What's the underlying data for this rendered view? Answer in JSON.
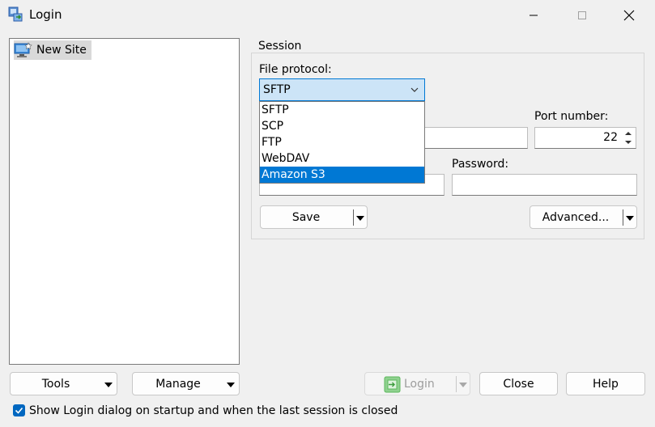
{
  "window": {
    "title": "Login"
  },
  "site_tree": {
    "items": [
      {
        "label": "New Site",
        "selected": true
      }
    ]
  },
  "session": {
    "legend": "Session",
    "file_protocol": {
      "label": "File protocol:",
      "value": "SFTP",
      "options": [
        "SFTP",
        "SCP",
        "FTP",
        "WebDAV",
        "Amazon S3"
      ],
      "highlighted": "Amazon S3"
    },
    "port": {
      "label": "Port number:",
      "value": "22"
    },
    "password": {
      "label": "Password:",
      "value": ""
    },
    "host_value": "",
    "user_value": "",
    "save_label": "Save",
    "advanced_label": "Advanced..."
  },
  "bottom": {
    "tools_label": "Tools",
    "manage_label": "Manage",
    "login_label": "Login",
    "close_label": "Close",
    "help_label": "Help"
  },
  "startup_checkbox": {
    "label": "Show Login dialog on startup and when the last session is closed",
    "checked": true
  },
  "colors": {
    "accent": "#0078d4",
    "select_bg": "#cce4f7",
    "login_icon": "#5cb85c"
  }
}
